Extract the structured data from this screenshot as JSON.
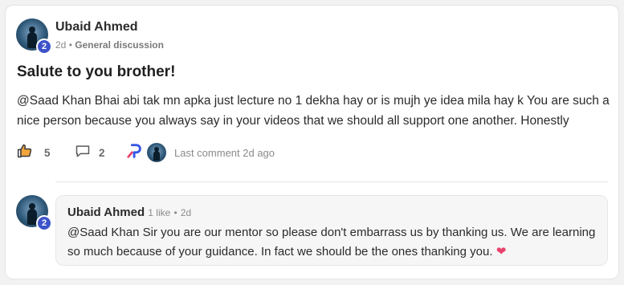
{
  "post": {
    "author": "Ubaid Ahmed",
    "level": "2",
    "time": "2d",
    "separator": "•",
    "category": "General discussion",
    "title": "Salute to you brother!",
    "body": "@Saad Khan Bhai abi tak mn apka just lecture no 1 dekha hay or is mujh ye idea mila hay k You are such a nice person because you always say in your videos that we should all support one another. Honestly",
    "likes": "5",
    "comments": "2",
    "last_comment": "Last comment 2d ago"
  },
  "reply": {
    "author": "Ubaid Ahmed",
    "level": "2",
    "likes_text": "1 like",
    "separator": "•",
    "time": "2d",
    "text": "@Saad Khan Sir you are our mentor so please don't embarrass us by thanking us. We are learning so much because of your guidance. In fact we should be the ones thanking you.",
    "emoji": "❤"
  },
  "colors": {
    "badge": "#3d54c9",
    "brand_p": "#3657e6",
    "heart": "#e8426c",
    "like_icon": "#f2a53a"
  },
  "icons": [
    "thumbs-up-icon",
    "comment-icon",
    "p-logo-icon",
    "heart-icon"
  ]
}
